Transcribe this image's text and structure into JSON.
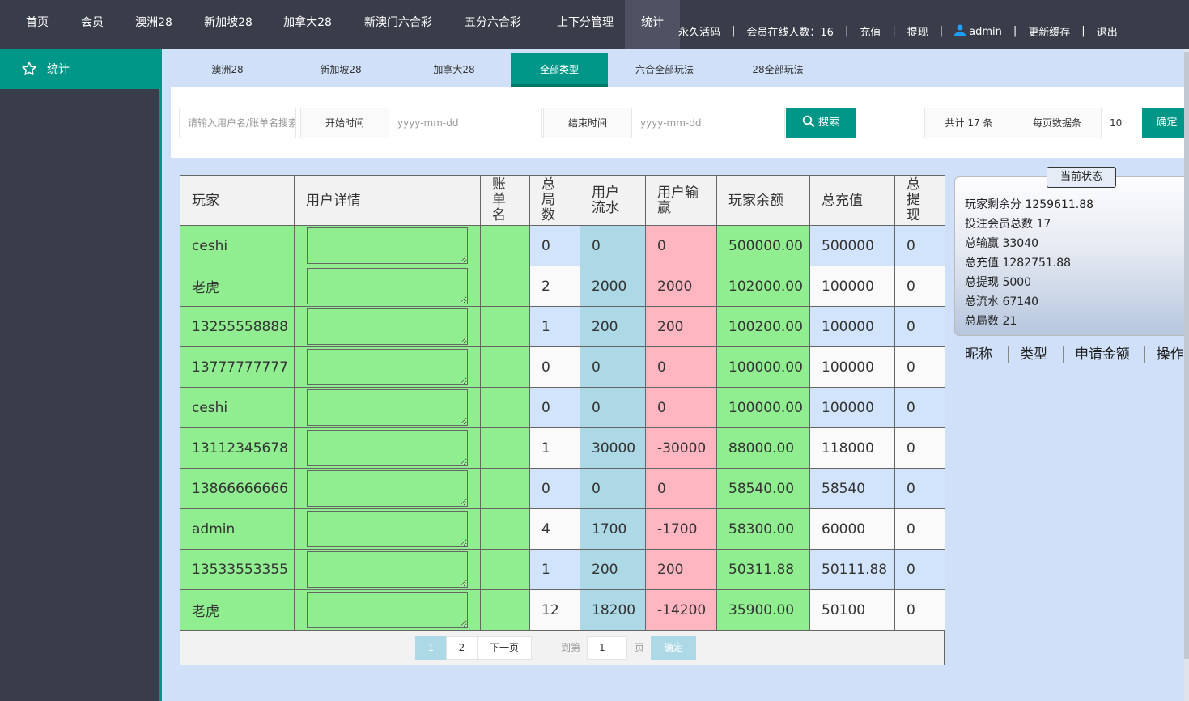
{
  "topnav": {
    "items": [
      {
        "label": "首页",
        "w": 0
      },
      {
        "label": "会员"
      },
      {
        "label": "澳洲28"
      },
      {
        "label": "新加坡28"
      },
      {
        "label": "加拿大28"
      },
      {
        "label": "新澳门六合彩"
      },
      {
        "label": "五分六合彩"
      },
      {
        "label": "上下分管理"
      },
      {
        "label": "统计"
      }
    ],
    "right": {
      "activation": "永久活码",
      "online": "会员在线人数：16",
      "recharge": "充值",
      "withdraw": "提现",
      "user": "admin",
      "refresh": "更新缓存",
      "logout": "退出"
    }
  },
  "sidebar": {
    "item": "统计"
  },
  "tabs": [
    "澳洲28",
    "新加坡28",
    "加拿大28",
    "全部类型",
    "六合全部玩法",
    "28全部玩法"
  ],
  "filter": {
    "search_placeholder": "请输入用户名/账单名搜索",
    "start_label": "开始时间",
    "start_placeholder": "yyyy-mm-dd",
    "end_label": "结束时间",
    "end_placeholder": "yyyy-mm-dd",
    "search_button": "搜索",
    "total": "共计 17 条",
    "per_page_label": "每页数据条",
    "per_page_value": "10",
    "confirm": "确定"
  },
  "table": {
    "headers": [
      "玩家",
      "用户详情",
      "账单名",
      "总局数",
      "用户流水",
      "用户输赢",
      "玩家余额",
      "总充值",
      "总提现"
    ],
    "rows": [
      [
        "ceshi",
        "",
        "",
        "0",
        "0",
        "0",
        "500000.00",
        "500000",
        "0"
      ],
      [
        "老虎",
        "",
        "",
        "2",
        "2000",
        "2000",
        "102000.00",
        "100000",
        "0"
      ],
      [
        "13255558888",
        "",
        "",
        "1",
        "200",
        "200",
        "100200.00",
        "100000",
        "0"
      ],
      [
        "13777777777",
        "",
        "",
        "0",
        "0",
        "0",
        "100000.00",
        "100000",
        "0"
      ],
      [
        "ceshi",
        "",
        "",
        "0",
        "0",
        "0",
        "100000.00",
        "100000",
        "0"
      ],
      [
        "13112345678",
        "",
        "",
        "1",
        "30000",
        "-30000",
        "88000.00",
        "118000",
        "0"
      ],
      [
        "13866666666",
        "",
        "",
        "0",
        "0",
        "0",
        "58540.00",
        "58540",
        "0"
      ],
      [
        "admin",
        "",
        "",
        "4",
        "1700",
        "-1700",
        "58300.00",
        "60000",
        "0"
      ],
      [
        "13533553355",
        "",
        "",
        "1",
        "200",
        "200",
        "50311.88",
        "50111.88",
        "0"
      ],
      [
        "老虎",
        "",
        "",
        "12",
        "18200",
        "-14200",
        "35900.00",
        "50100",
        "0"
      ]
    ]
  },
  "pager": {
    "page1": "1",
    "page2": "2",
    "next": "下一页",
    "goto": "到第",
    "goto_value": "1",
    "page_unit": "页",
    "confirm": "确定"
  },
  "status": {
    "title": "当前状态",
    "lines": [
      "玩家剩余分 1259611.88",
      "投注会员总数 17",
      "总输赢 33040",
      "总充值 1282751.88",
      "总提现 5000",
      "总流水 67140",
      "总局数 21"
    ]
  },
  "withdraw_table": {
    "headers": [
      "昵称",
      "类型",
      "申请金额",
      "操作"
    ]
  }
}
